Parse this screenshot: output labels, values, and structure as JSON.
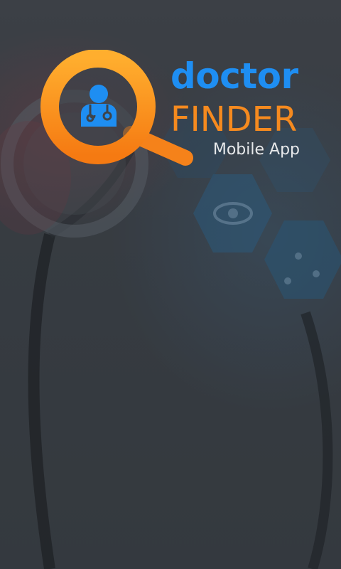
{
  "app": {
    "brand_line1": "doctor",
    "brand_line2": "FINDER",
    "tagline": "Mobile App"
  },
  "colors": {
    "brand_blue": "#1e8ef2",
    "brand_orange": "#f58a1f",
    "background": "#3f454b",
    "tagline_text": "#e6e8ea"
  },
  "icons": {
    "logo": "magnifier-icon",
    "inner": "doctor-icon",
    "background_decor": "stethoscope-hexagon-medical-background"
  }
}
